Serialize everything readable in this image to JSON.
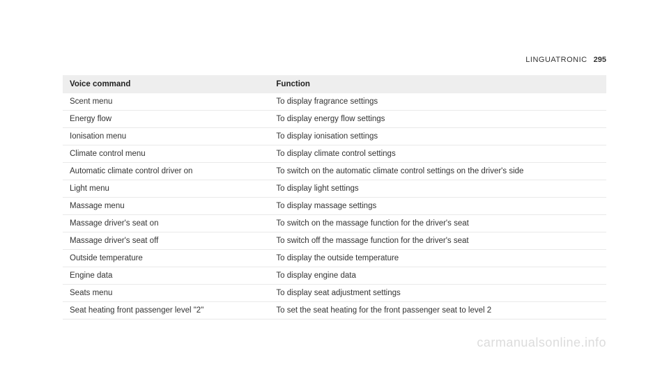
{
  "header": {
    "section_name": "LINGUATRONIC",
    "page_number": "295"
  },
  "table": {
    "headers": {
      "voice_command": "Voice command",
      "function": "Function"
    },
    "rows": [
      {
        "voice": "Scent menu",
        "func": "To display fragrance settings"
      },
      {
        "voice": "Energy flow",
        "func": "To display energy flow settings"
      },
      {
        "voice": "Ionisation menu",
        "func": "To display ionisation settings"
      },
      {
        "voice": "Climate control menu",
        "func": "To display climate control settings"
      },
      {
        "voice": "Automatic climate control driver on",
        "func": "To switch on the automatic climate control settings on the driver's side"
      },
      {
        "voice": "Light menu",
        "func": "To display light settings"
      },
      {
        "voice": "Massage menu",
        "func": "To display massage settings"
      },
      {
        "voice": "Massage driver's seat on",
        "func": "To switch on the massage function for the driver's seat"
      },
      {
        "voice": "Massage driver's seat off",
        "func": "To switch off the massage function for the driver's seat"
      },
      {
        "voice": "Outside temperature",
        "func": "To display the outside temperature"
      },
      {
        "voice": "Engine data",
        "func": "To display engine data"
      },
      {
        "voice": "Seats menu",
        "func": "To display seat adjustment settings"
      },
      {
        "voice": "Seat heating front passenger level \"2\"",
        "func": "To set the seat heating for the front passenger seat to level 2"
      }
    ]
  },
  "watermark": "carmanualsonline.info"
}
